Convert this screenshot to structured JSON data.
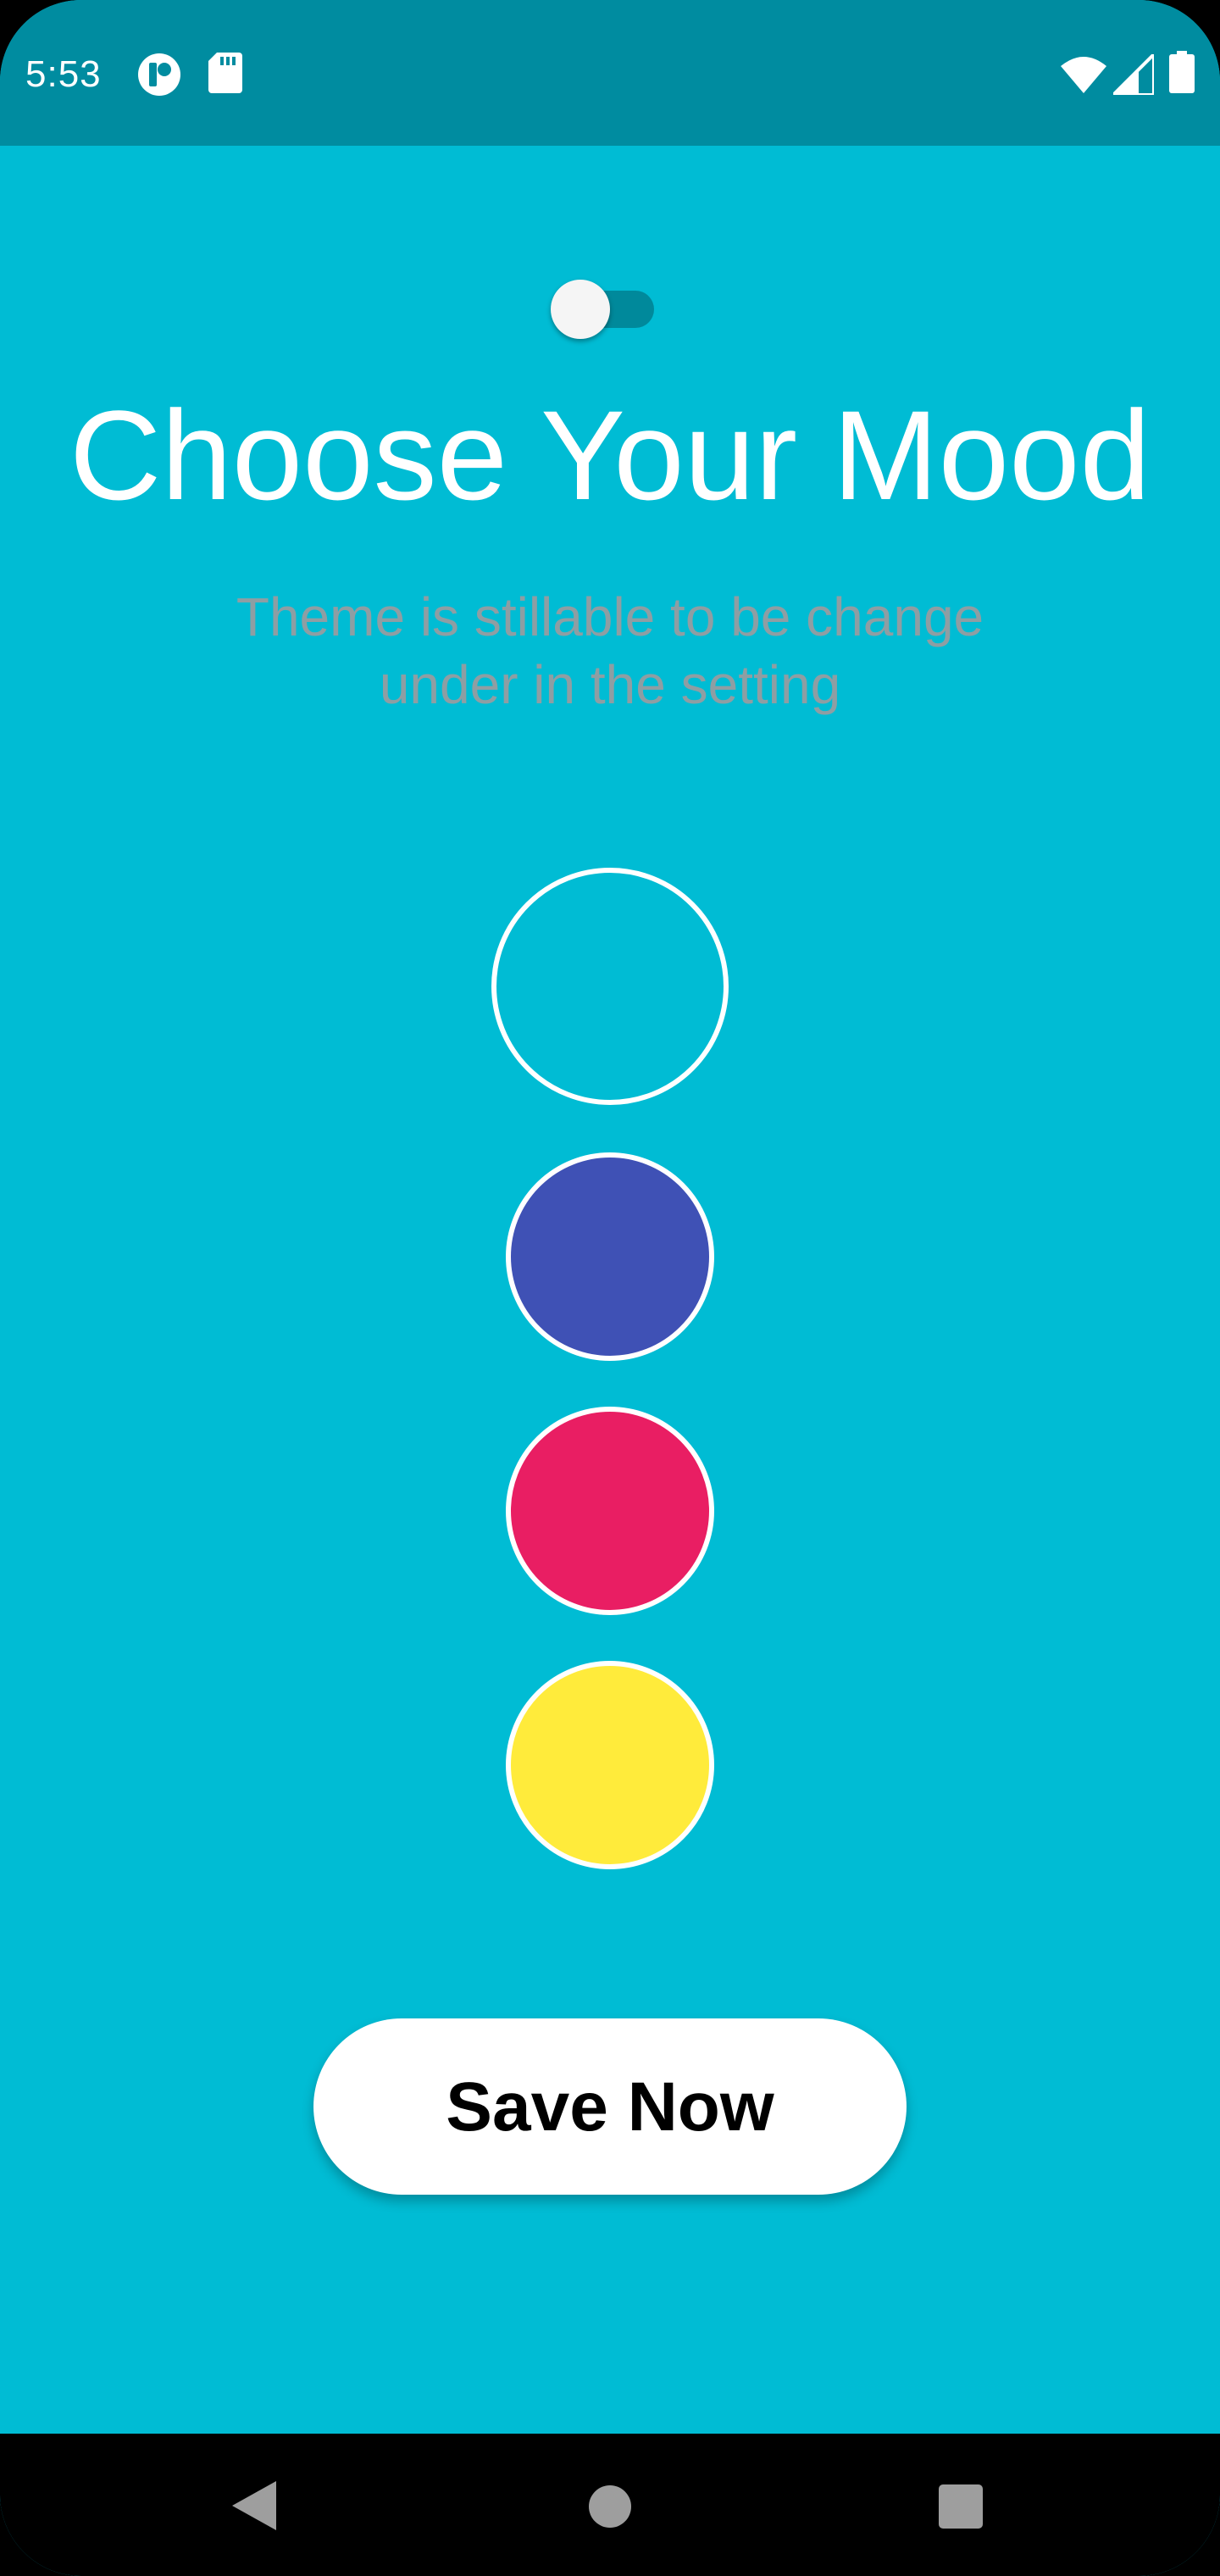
{
  "status_bar": {
    "time": "5:53",
    "icons": [
      "app-notification-icon",
      "sd-card-icon",
      "wifi-icon",
      "cellular-signal-icon",
      "battery-icon"
    ]
  },
  "theme_toggle": {
    "state": "off"
  },
  "title": "Choose Your Mood",
  "subtitle": {
    "line1": "Theme is stillable to be change",
    "line2": "under in the setting"
  },
  "color_options": [
    {
      "name": "cyan",
      "color": "#00BCD4"
    },
    {
      "name": "indigo",
      "color": "#3F51B5"
    },
    {
      "name": "pink",
      "color": "#E91E63"
    },
    {
      "name": "yellow",
      "color": "#FFEB3B"
    }
  ],
  "save_button": {
    "label": "Save Now"
  },
  "nav_bar": {
    "icons": [
      "back-icon",
      "home-icon",
      "recents-icon"
    ]
  },
  "colors": {
    "background": "#00BCD4",
    "status_bar": "#008CA0",
    "subtitle_text": "#8E9EA3",
    "button_bg": "#FFFFFF"
  }
}
